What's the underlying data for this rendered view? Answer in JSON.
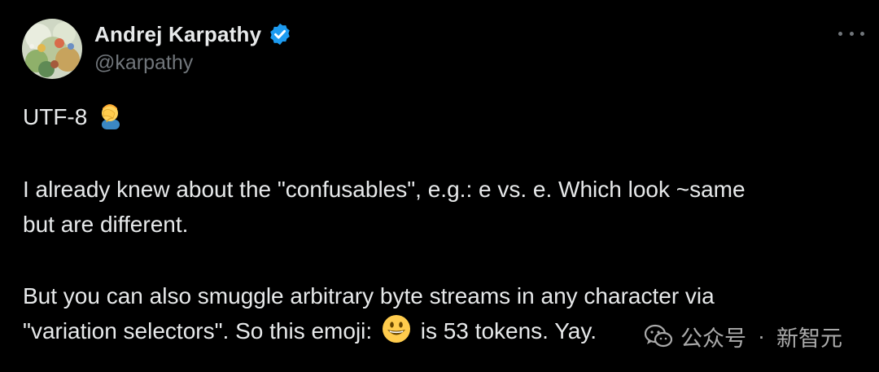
{
  "author": {
    "display_name": "Andrej Karpathy",
    "handle": "@karpathy",
    "verified": true,
    "verified_color": "#1d9bf0"
  },
  "tweet": {
    "line1_text": "UTF-8",
    "line1_emoji": "face-palm-emoji",
    "line2": "I already knew about the \"confusables\", e.g.: e vs. е. Which look ~same",
    "line3": "but are different.",
    "line4": "But you can also smuggle arbitrary byte streams in any character via",
    "line5_before": "\"variation selectors\". So this emoji:",
    "line5_emoji": "grinning-face-emoji",
    "line5_after": "is 53 tokens. Yay."
  },
  "more_button": {
    "icon": "more-dots-icon"
  },
  "watermark": {
    "icon": "wechat-icon",
    "text_left": "公众号",
    "separator": "·",
    "text_right": "新智元"
  },
  "colors": {
    "background": "#000000",
    "text": "#e7e9ea",
    "secondary": "#71767b"
  }
}
